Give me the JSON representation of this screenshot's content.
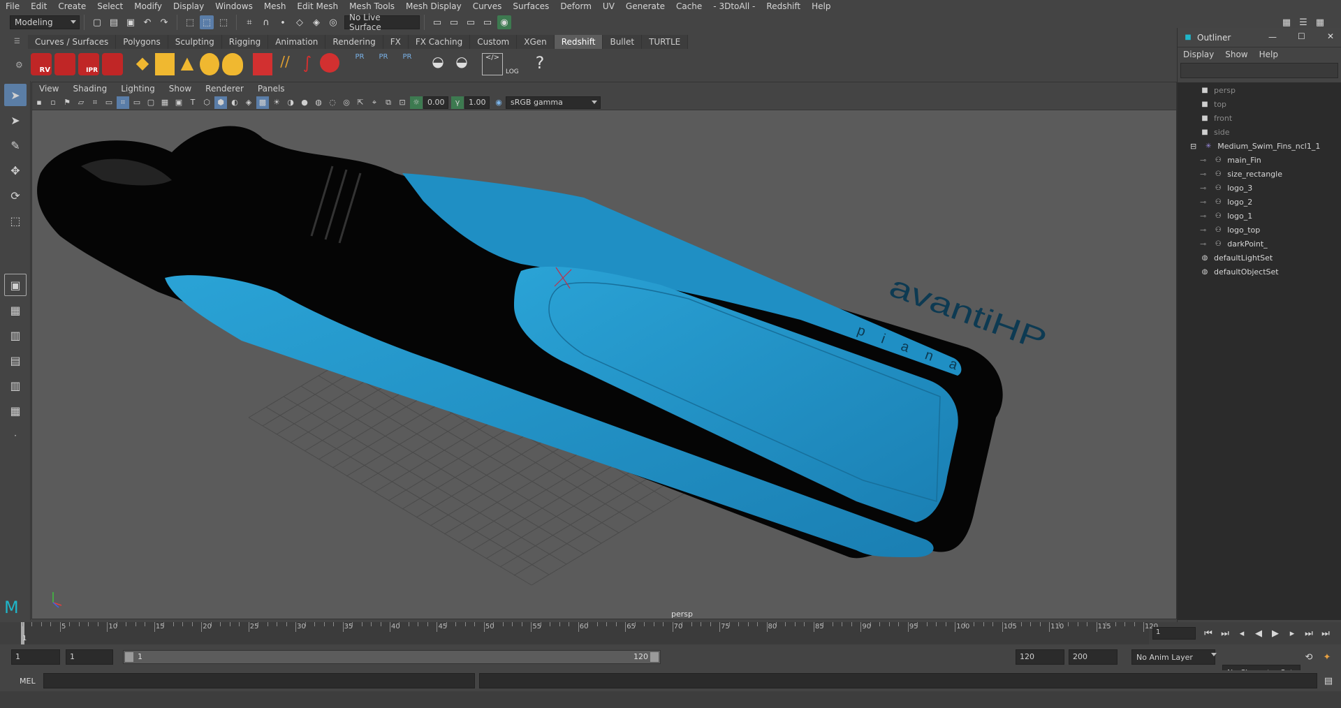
{
  "menubar": [
    "File",
    "Edit",
    "Create",
    "Select",
    "Modify",
    "Display",
    "Windows",
    "Mesh",
    "Edit Mesh",
    "Mesh Tools",
    "Mesh Display",
    "Curves",
    "Surfaces",
    "Deform",
    "UV",
    "Generate",
    "Cache",
    "- 3DtoAll -",
    "Redshift",
    "Help"
  ],
  "statusline": {
    "mode": "Modeling",
    "live_surface": "No Live Surface"
  },
  "shelf_tabs": [
    "Curves / Surfaces",
    "Polygons",
    "Sculpting",
    "Rigging",
    "Animation",
    "Rendering",
    "FX",
    "FX Caching",
    "Custom",
    "XGen",
    "Redshift",
    "Bullet",
    "TURTLE"
  ],
  "shelf_active": "Redshift",
  "shelf_icons": [
    "RV",
    "IPR",
    "PR",
    "PR",
    "PR",
    "LOG",
    "?"
  ],
  "panel_menu": [
    "View",
    "Shading",
    "Lighting",
    "Show",
    "Renderer",
    "Panels"
  ],
  "panel_tools": {
    "exposure": "0.00",
    "gamma": "1.00",
    "color_space": "sRGB gamma"
  },
  "viewport": {
    "camera_label": "persp",
    "logo_small": "p i a n a",
    "logo_big": "avantiHP",
    "colors": {
      "fin": "#1f8fc4",
      "rubber": "#0a0a0a",
      "viewport_bg": "#5b5b5b"
    }
  },
  "outliner": {
    "title": "Outliner",
    "menu": [
      "Display",
      "Show",
      "Help"
    ],
    "nodes": [
      {
        "label": "persp",
        "type": "camera",
        "dim": true
      },
      {
        "label": "top",
        "type": "camera",
        "dim": true
      },
      {
        "label": "front",
        "type": "camera",
        "dim": true
      },
      {
        "label": "side",
        "type": "camera",
        "dim": true
      },
      {
        "label": "Medium_Swim_Fins_ncl1_1",
        "type": "group",
        "dim": false
      },
      {
        "label": "main_Fin",
        "type": "mesh",
        "dim": false
      },
      {
        "label": "size_rectangle",
        "type": "mesh",
        "dim": false
      },
      {
        "label": "logo_3",
        "type": "mesh",
        "dim": false
      },
      {
        "label": "logo_2",
        "type": "mesh",
        "dim": false
      },
      {
        "label": "logo_1",
        "type": "mesh",
        "dim": false
      },
      {
        "label": "logo_top",
        "type": "mesh",
        "dim": false
      },
      {
        "label": "darkPoint_",
        "type": "mesh",
        "dim": false
      },
      {
        "label": "defaultLightSet",
        "type": "set",
        "dim": false
      },
      {
        "label": "defaultObjectSet",
        "type": "set",
        "dim": false
      }
    ]
  },
  "timeline": {
    "ticks": [
      "5",
      "10",
      "15",
      "20",
      "25",
      "30",
      "35",
      "40",
      "45",
      "50",
      "55",
      "60",
      "65",
      "70",
      "75",
      "80",
      "85",
      "90",
      "95",
      "100",
      "105",
      "110",
      "115",
      "120"
    ],
    "current_frame": "1",
    "start_marker": "1"
  },
  "range": {
    "start": "1",
    "playback_start": "1",
    "slider_start": "1",
    "slider_end": "120",
    "playback_end": "120",
    "end": "200",
    "anim_layer": "No Anim Layer",
    "character_set": "No Character Set"
  },
  "cmdline": {
    "label": "MEL"
  }
}
